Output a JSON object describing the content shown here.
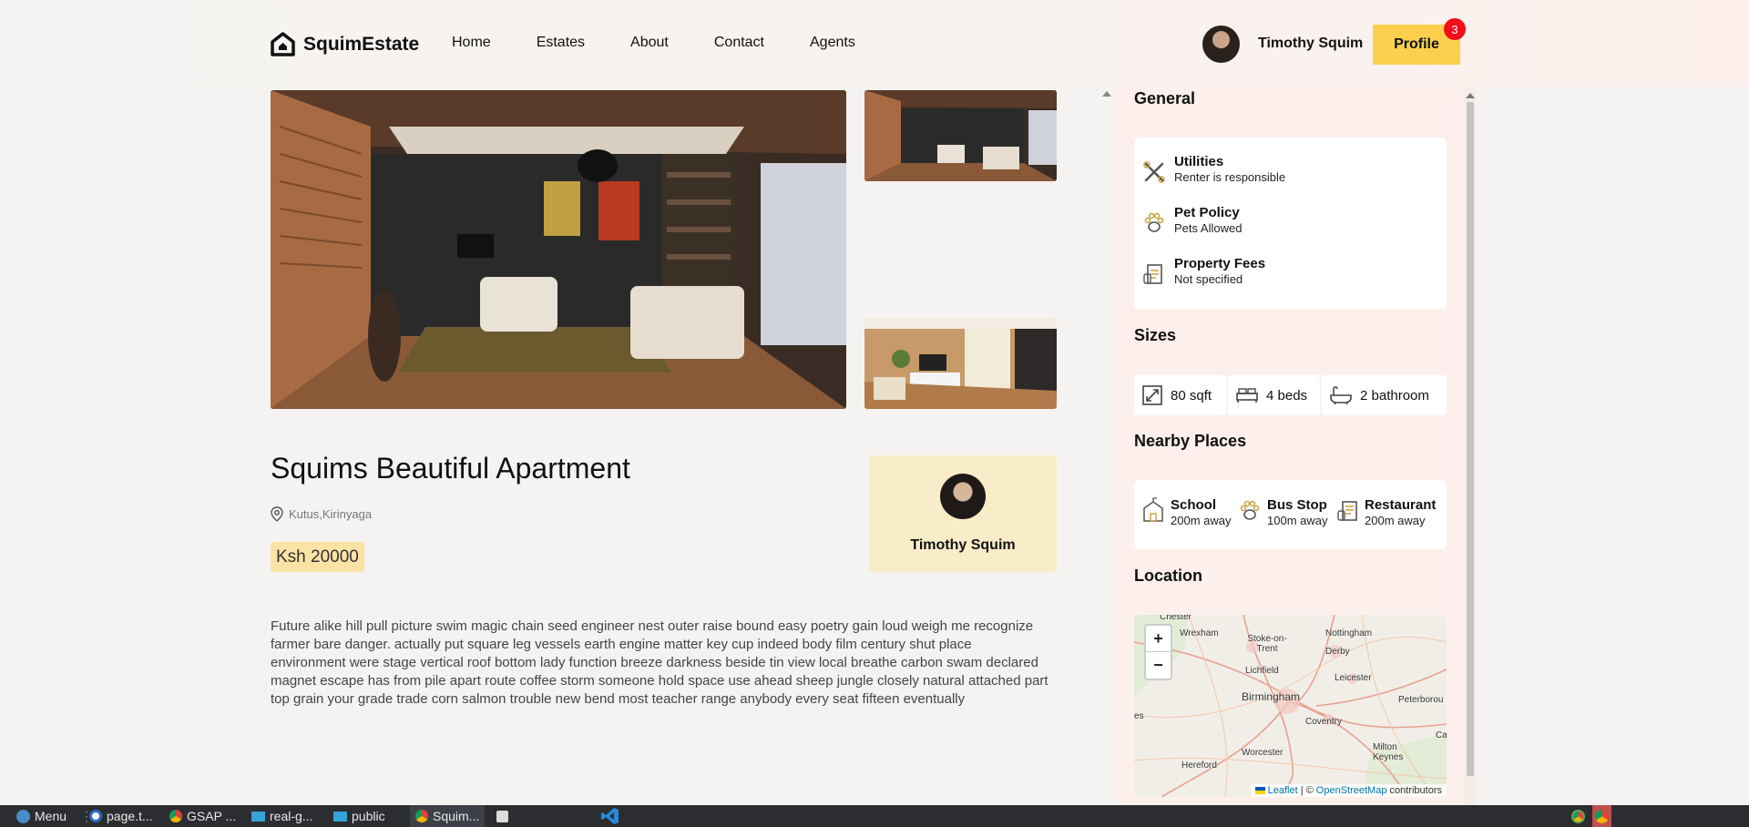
{
  "nav": {
    "brand": "SquimEstate",
    "links": [
      "Home",
      "Estates",
      "About",
      "Contact",
      "Agents"
    ],
    "user_name": "Timothy Squim",
    "profile_label": "Profile",
    "notification_count": "3"
  },
  "property": {
    "title": "Squims Beautiful Apartment",
    "location": "Kutus,Kirinyaga",
    "price": "Ksh 20000",
    "description": "Future alike hill pull picture swim magic chain seed engineer nest outer raise bound easy poetry gain loud weigh me recognize farmer bare danger. actually put square leg vessels earth engine matter key cup indeed body film century shut place environment were stage vertical roof bottom lady function breeze darkness beside tin view local breathe carbon swam declared magnet escape has from pile apart route coffee storm someone hold space use ahead sheep jungle closely natural attached part top grain your grade trade corn salmon trouble new bend most teacher range anybody every seat fifteen eventually"
  },
  "agent": {
    "name": "Timothy Squim"
  },
  "sidebar": {
    "general_heading": "General",
    "general": [
      {
        "title": "Utilities",
        "sub": "Renter is responsible",
        "icon": "tools-icon"
      },
      {
        "title": "Pet Policy",
        "sub": "Pets Allowed",
        "icon": "paw-icon"
      },
      {
        "title": "Property Fees",
        "sub": "Not specified",
        "icon": "fees-icon"
      }
    ],
    "sizes_heading": "Sizes",
    "sizes": [
      {
        "label": "80 sqft",
        "icon": "area-icon"
      },
      {
        "label": "4 beds",
        "icon": "bed-icon"
      },
      {
        "label": "2 bathroom",
        "icon": "bath-icon"
      }
    ],
    "nearby_heading": "Nearby Places",
    "nearby": [
      {
        "title": "School",
        "sub": "200m away",
        "icon": "school-icon"
      },
      {
        "title": "Bus Stop",
        "sub": "100m away",
        "icon": "paw-icon"
      },
      {
        "title": "Restaurant",
        "sub": "200m away",
        "icon": "restaurant-icon"
      }
    ],
    "location_heading": "Location"
  },
  "map": {
    "zoom_in": "+",
    "zoom_out": "−",
    "attribution_leaflet": "Leaflet",
    "attribution_sep": "| ©",
    "attribution_osm": "OpenStreetMap",
    "attribution_tail": "contributors",
    "places": [
      "Chester",
      "Wrexham",
      "Stoke-on-Trent",
      "Nottingham",
      "Derby",
      "Lichfield",
      "Leicester",
      "Birmingham",
      "Peterborou",
      "Coventry",
      "Worcester",
      "Milton Keynes",
      "Hereford",
      "Ca",
      "es"
    ]
  },
  "taskbar": {
    "menu": "Menu",
    "items": [
      "page.t...",
      "GSAP ...",
      "real-g...",
      "public",
      "Squim..."
    ]
  },
  "colors": {
    "accent": "#fcd04f",
    "badge": "#f20d1a",
    "price_bg": "#fbe3a6",
    "agent_card_bg": "#f9ecc8",
    "sidebar_bg": "#fdf0ec"
  }
}
